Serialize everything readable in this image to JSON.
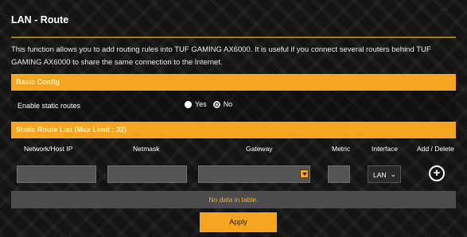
{
  "page": {
    "title": "LAN - Route",
    "description": "This function allows you to add routing rules into TUF GAMING AX6000. It is useful if you connect several routers behind TUF GAMING AX6000 to share the same connection to the Internet."
  },
  "basic_config": {
    "header": "Basic Config",
    "enable_static_routes": {
      "label": "Enable static routes",
      "options": [
        "Yes",
        "No"
      ],
      "selected": "Yes"
    }
  },
  "static_route_list": {
    "header": "Static Route List (Max Limit : 32)",
    "columns": [
      "Network/Host IP",
      "Netmask",
      "Gateway",
      "Metric",
      "Interface",
      "Add / Delete"
    ],
    "inputs": {
      "network_host_ip": "",
      "netmask": "",
      "gateway": "",
      "metric": "",
      "interface": "LAN"
    },
    "empty_message": "No data in table."
  },
  "actions": {
    "apply_label": "Apply"
  },
  "icons": {
    "gateway_dropdown": "caret-down-icon",
    "interface_dropdown": "chevron-down-icon",
    "add": "add-circle-icon"
  },
  "colors": {
    "accent": "#f6a521",
    "background": "#141414",
    "empty_text": "#f6b030"
  }
}
